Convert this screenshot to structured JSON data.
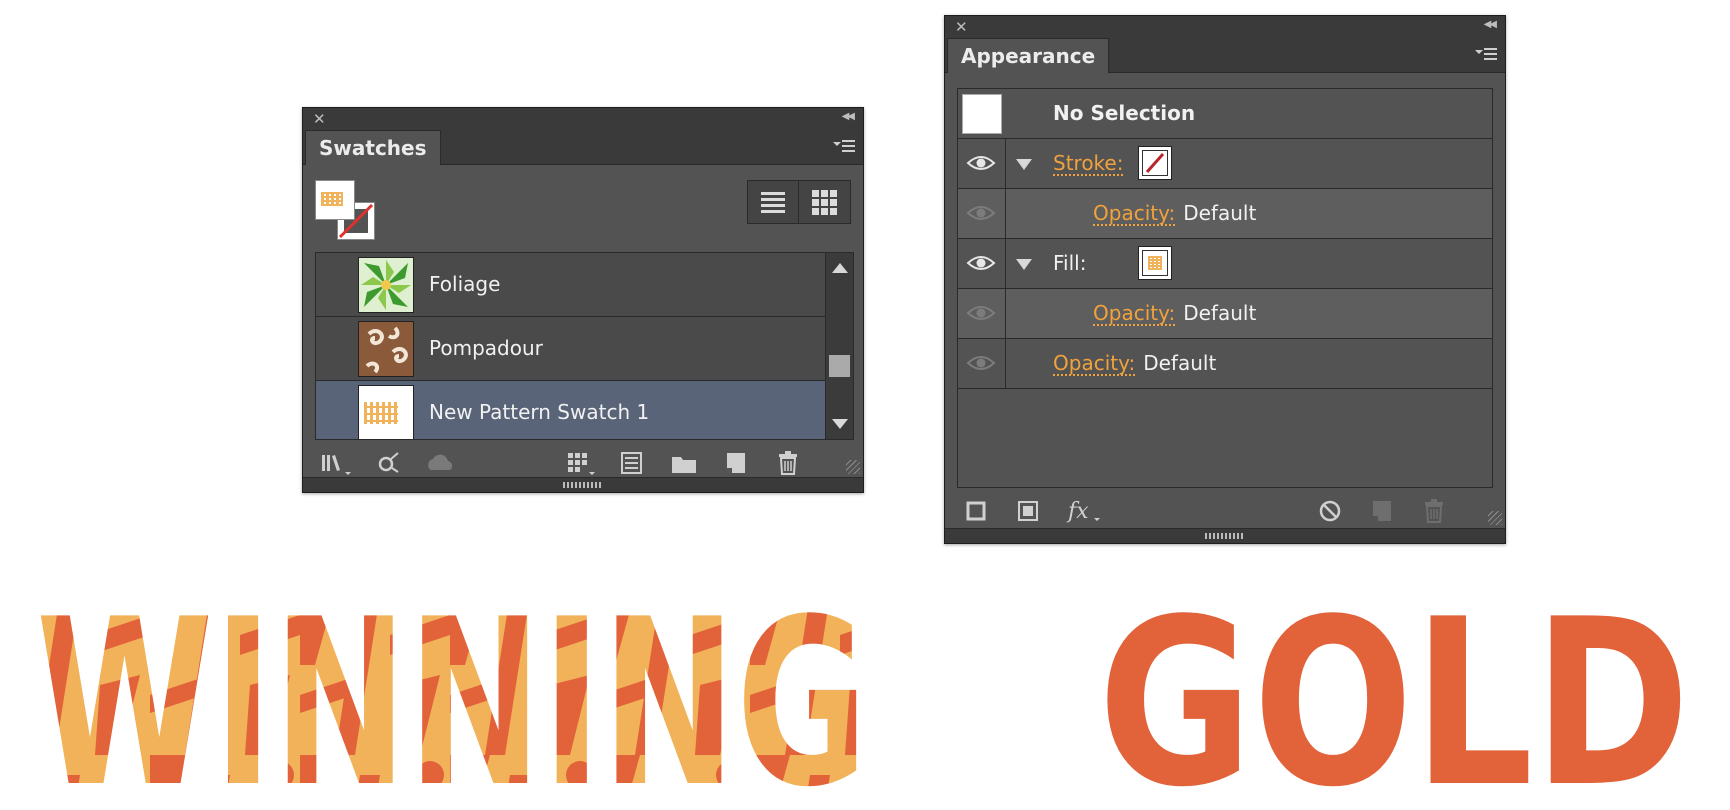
{
  "swatches_panel": {
    "tab_label": "Swatches",
    "items": [
      {
        "label": "Foliage"
      },
      {
        "label": "Pompadour"
      },
      {
        "label": "New Pattern Swatch 1"
      }
    ],
    "selected_index": 2
  },
  "appearance_panel": {
    "tab_label": "Appearance",
    "header": "No Selection",
    "stroke_label": "Stroke:",
    "stroke_opacity_label": "Opacity:",
    "stroke_opacity_value": "Default",
    "fill_label": "Fill:",
    "fill_opacity_label": "Opacity:",
    "fill_opacity_value": "Default",
    "object_opacity_label": "Opacity:",
    "object_opacity_value": "Default"
  },
  "artwork": {
    "text": "WINNING GOLD",
    "colors": {
      "orange": "#e2623a",
      "gold": "#f2b25a"
    }
  },
  "colors": {
    "panel_bg": "#535353",
    "link": "#f0a23c",
    "selection": "#5a6478"
  }
}
